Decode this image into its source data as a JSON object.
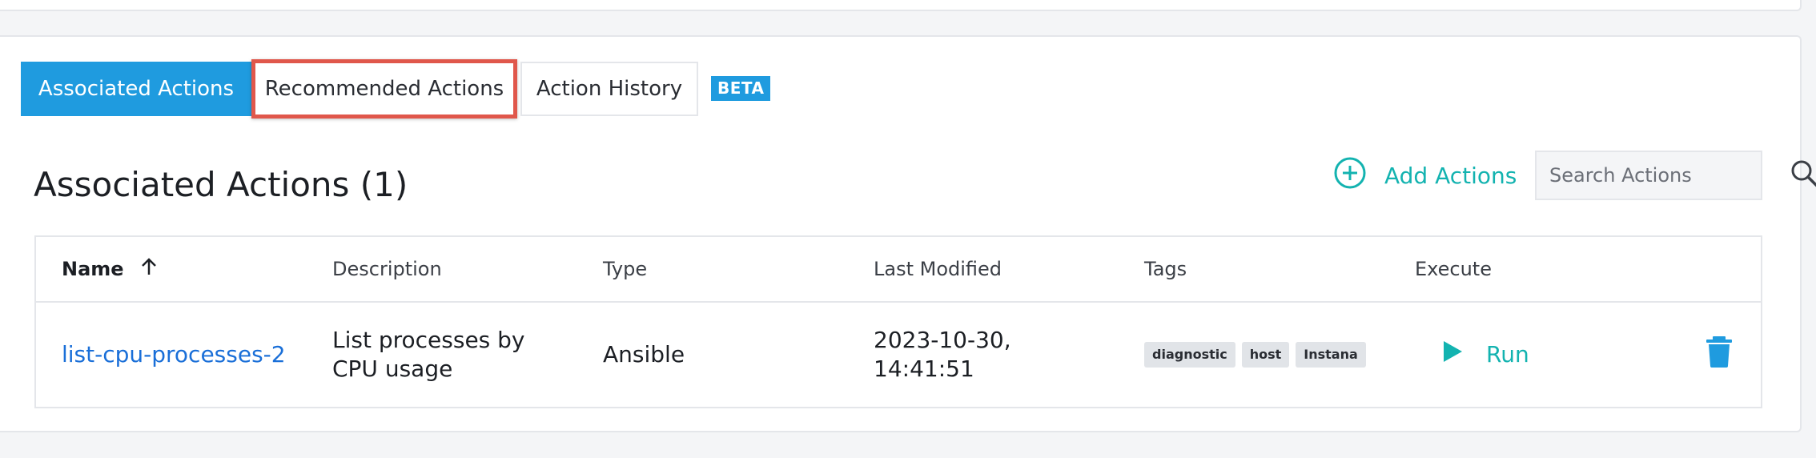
{
  "tabs": {
    "associated": "Associated Actions",
    "recommended": "Recommended Actions",
    "history": "Action History",
    "beta_badge": "BETA"
  },
  "section": {
    "title": "Associated Actions (1)",
    "add_label": "Add Actions",
    "search_placeholder": "Search Actions"
  },
  "table": {
    "headers": {
      "name": "Name",
      "description": "Description",
      "type": "Type",
      "last_modified": "Last Modified",
      "tags": "Tags",
      "execute": "Execute"
    },
    "rows": [
      {
        "name": "list-cpu-processes-2",
        "description_line1": "List processes by",
        "description_line2": "CPU usage",
        "type": "Ansible",
        "last_modified_line1": "2023-10-30,",
        "last_modified_line2": "14:41:51",
        "tags": [
          "diagnostic",
          "host",
          "Instana"
        ],
        "run_label": "Run"
      }
    ]
  },
  "colors": {
    "accent_blue": "#1f9bdf",
    "teal": "#13b3b0",
    "link_blue": "#1a6fd8",
    "highlight_red": "#e0574b"
  },
  "icons": {
    "add": "plus-circle-icon",
    "search": "search-icon",
    "sort": "arrow-up-icon",
    "run": "play-icon",
    "delete": "trash-icon"
  }
}
